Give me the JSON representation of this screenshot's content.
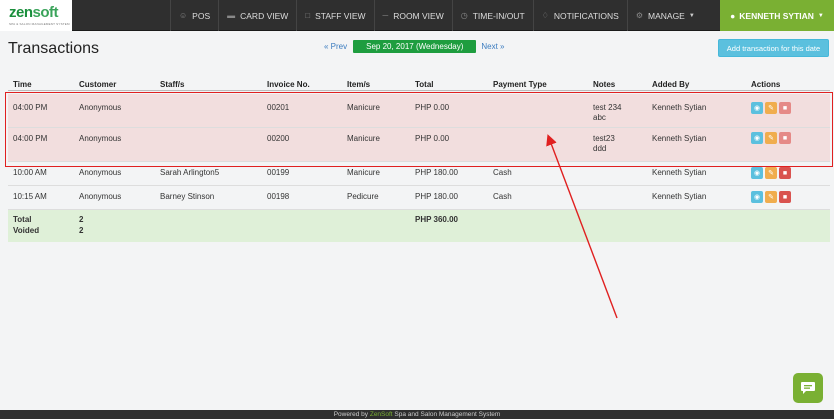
{
  "brand": {
    "logo_zen": "zen",
    "logo_soft": "soft",
    "tagline": "SPA & SALON MANAGEMENT SYSTEM"
  },
  "nav": {
    "items": [
      {
        "label": "POS",
        "icon": "users-icon"
      },
      {
        "label": "CARD VIEW",
        "icon": "card-icon"
      },
      {
        "label": "STAFF VIEW",
        "icon": "calendar-icon"
      },
      {
        "label": "ROOM VIEW",
        "icon": "bed-icon"
      },
      {
        "label": "TIME-IN/OUT",
        "icon": "clock-icon"
      },
      {
        "label": "NOTIFICATIONS",
        "icon": "bell-icon"
      },
      {
        "label": "MANAGE",
        "icon": "gear-icon"
      }
    ],
    "user": "KENNETH SYTIAN"
  },
  "page": {
    "title": "Transactions"
  },
  "date_nav": {
    "prev": "« Prev",
    "date": "Sep 20, 2017 (Wednesday)",
    "next": "Next »"
  },
  "add_button": "Add transaction for this date",
  "table": {
    "headers": [
      "Time",
      "Customer",
      "Staff/s",
      "Invoice No.",
      "Item/s",
      "Total",
      "Payment Type",
      "Notes",
      "Added By",
      "Actions"
    ],
    "rows": [
      {
        "time": "04:00 PM",
        "customer": "Anonymous",
        "staff": "",
        "invoice": "00201",
        "items": "Manicure",
        "total": "PHP 0.00",
        "payment": "",
        "notes1": "test 234",
        "notes2": "abc",
        "added_by": "Kenneth Sytian"
      },
      {
        "time": "04:00 PM",
        "customer": "Anonymous",
        "staff": "",
        "invoice": "00200",
        "items": "Manicure",
        "total": "PHP 0.00",
        "payment": "",
        "notes1": "test23",
        "notes2": "ddd",
        "added_by": "Kenneth Sytian"
      },
      {
        "time": "10:00 AM",
        "customer": "Anonymous",
        "staff": "Sarah Arlington5",
        "invoice": "00199",
        "items": "Manicure",
        "total": "PHP 180.00",
        "payment": "Cash",
        "notes1": "",
        "notes2": "",
        "added_by": "Kenneth Sytian"
      },
      {
        "time": "10:15 AM",
        "customer": "Anonymous",
        "staff": "Barney Stinson",
        "invoice": "00198",
        "items": "Pedicure",
        "total": "PHP 180.00",
        "payment": "Cash",
        "notes1": "",
        "notes2": "",
        "added_by": "Kenneth Sytian"
      }
    ],
    "summary": {
      "total_label": "Total",
      "total_count": "2",
      "voided_label": "Voided",
      "voided_count": "2",
      "total_amount": "PHP 360.00"
    }
  },
  "footer": {
    "prefix": "Powered by ",
    "brand": "ZenSoft",
    "suffix": " Spa and Salon Management System"
  },
  "colors": {
    "nav_bg": "#2f2f2f",
    "user_green": "#7ab033",
    "date_green": "#1e9d3f",
    "highlight_red": "#e02020",
    "row_highlight": "#f2dede",
    "total_green": "#dff0d8"
  }
}
